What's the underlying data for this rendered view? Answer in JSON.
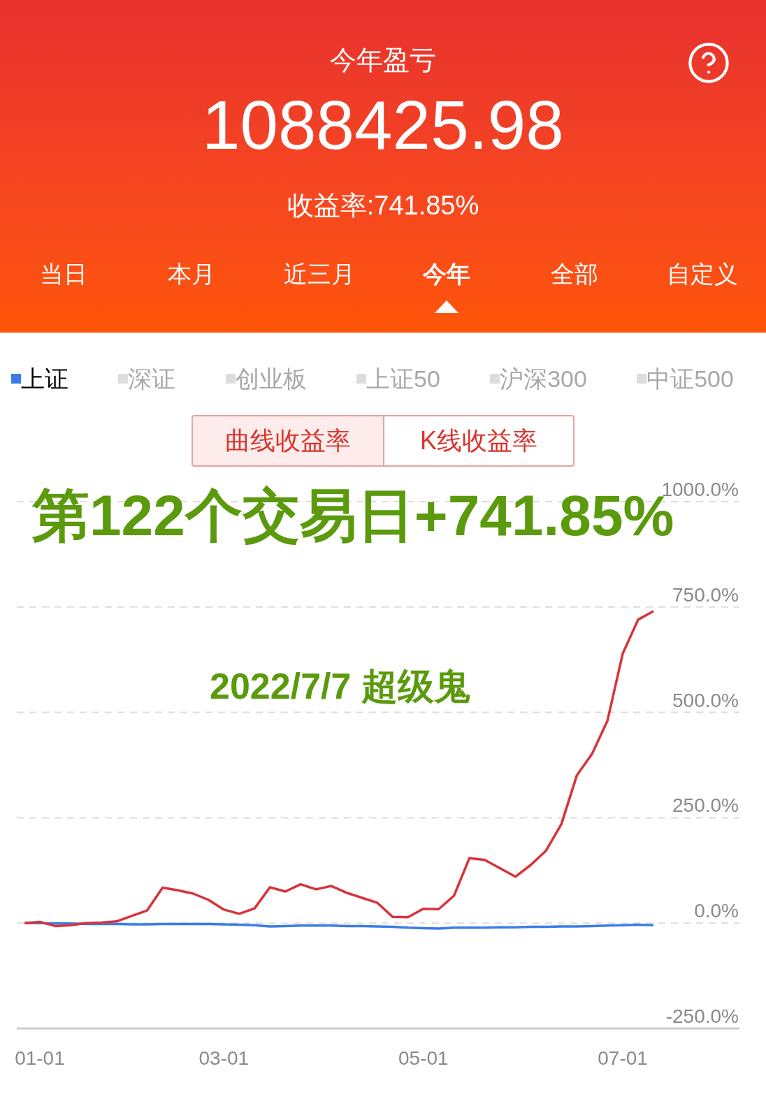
{
  "header": {
    "title": "今年盈亏",
    "amount": "1088425.98",
    "return_rate": "收益率:741.85%"
  },
  "period_tabs": [
    {
      "label": "当日",
      "selected": false
    },
    {
      "label": "本月",
      "selected": false
    },
    {
      "label": "近三月",
      "selected": false
    },
    {
      "label": "今年",
      "selected": true
    },
    {
      "label": "全部",
      "selected": false
    },
    {
      "label": "自定义",
      "selected": false
    }
  ],
  "index_options": [
    {
      "label": "上证",
      "selected": true
    },
    {
      "label": "深证",
      "selected": false
    },
    {
      "label": "创业板",
      "selected": false
    },
    {
      "label": "上证50",
      "selected": false
    },
    {
      "label": "沪深300",
      "selected": false
    },
    {
      "label": "中证500",
      "selected": false
    }
  ],
  "chart_modes": [
    {
      "label": "曲线收益率",
      "selected": true
    },
    {
      "label": "K线收益率",
      "selected": false
    }
  ],
  "annotations": [
    "第122个交易日+741.85%",
    "2022/7/7 超级鬼"
  ],
  "chart": {
    "chart_data": {
      "type": "line",
      "categories": [
        null,
        "01-01",
        null,
        null,
        null,
        null,
        null,
        null,
        null,
        null,
        null,
        null,
        null,
        "03-01",
        null,
        null,
        null,
        null,
        null,
        null,
        null,
        null,
        null,
        null,
        null,
        null,
        "05-01",
        null,
        null,
        null,
        null,
        null,
        null,
        null,
        null,
        null,
        null,
        null,
        null,
        "07-01",
        null,
        null
      ],
      "series": [
        {
          "color": "#d8333a",
          "values": [
            0,
            3,
            -7,
            -5,
            0,
            1,
            4,
            17,
            30,
            84,
            78,
            70,
            55,
            32,
            22,
            35,
            85,
            75,
            92,
            80,
            88,
            72,
            60,
            48,
            15,
            14,
            34,
            33,
            65,
            154,
            150,
            130,
            110,
            138,
            172,
            235,
            350,
            402,
            480,
            640,
            720,
            740
          ]
        },
        {
          "color": "#3b7de8",
          "values": [
            0,
            0,
            -1,
            -1,
            -2,
            -2,
            -2,
            -3,
            -3,
            -2,
            -2,
            -2,
            -2,
            -3,
            -4,
            -5,
            -8,
            -7,
            -6,
            -6,
            -6,
            -7,
            -7,
            -8,
            -9,
            -11,
            -12,
            -13,
            -11,
            -11,
            -11,
            -10,
            -10,
            -9,
            -9,
            -8,
            -8,
            -7,
            -6,
            -5,
            -4,
            -5
          ]
        }
      ],
      "grid": true,
      "ylim": [
        -250,
        1000
      ],
      "yticks": [
        {
          "value": 1000,
          "label": "1000.0%"
        },
        {
          "value": 750,
          "label": "750.0%"
        },
        {
          "value": 500,
          "label": "500.0%"
        },
        {
          "value": 250,
          "label": "250.0%"
        },
        {
          "value": 0,
          "label": "0.0%"
        },
        {
          "value": -250,
          "label": "-250.0%"
        }
      ]
    }
  }
}
